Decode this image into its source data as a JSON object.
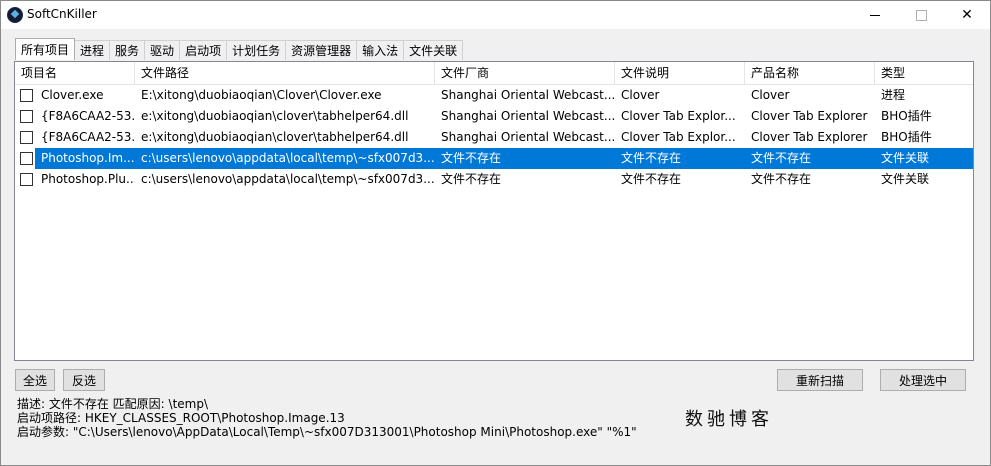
{
  "window": {
    "title": "SoftCnKiller"
  },
  "tabs": [
    "所有项目",
    "进程",
    "服务",
    "驱动",
    "启动项",
    "计划任务",
    "资源管理器",
    "输入法",
    "文件关联"
  ],
  "columns": [
    "项目名",
    "文件路径",
    "文件厂商",
    "文件说明",
    "产品名称",
    "类型"
  ],
  "rows": [
    {
      "name": "Clover.exe",
      "path": "E:\\xitong\\duobiaoqian\\Clover\\Clover.exe",
      "vendor": "Shanghai Oriental Webcast...",
      "desc": "Clover",
      "product": "Clover",
      "type": "进程"
    },
    {
      "name": "{F8A6CAA2-53...",
      "path": "e:\\xitong\\duobiaoqian\\clover\\tabhelper64.dll",
      "vendor": "Shanghai Oriental Webcast...",
      "desc": "Clover Tab Explor...",
      "product": "Clover Tab Explorer",
      "type": "BHO插件"
    },
    {
      "name": "{F8A6CAA2-53...",
      "path": "e:\\xitong\\duobiaoqian\\clover\\tabhelper64.dll",
      "vendor": "Shanghai Oriental Webcast...",
      "desc": "Clover Tab Explor...",
      "product": "Clover Tab Explorer",
      "type": "BHO插件"
    },
    {
      "name": "Photoshop.Im...",
      "path": "c:\\users\\lenovo\\appdata\\local\\temp\\~sfx007d3...",
      "vendor": "文件不存在",
      "desc": "文件不存在",
      "product": "文件不存在",
      "type": "文件关联"
    },
    {
      "name": "Photoshop.Plu...",
      "path": "c:\\users\\lenovo\\appdata\\local\\temp\\~sfx007d3...",
      "vendor": "文件不存在",
      "desc": "文件不存在",
      "product": "文件不存在",
      "type": "文件关联"
    }
  ],
  "buttons": {
    "select_all": "全选",
    "invert": "反选",
    "rescan": "重新扫描",
    "process": "处理选中"
  },
  "details": {
    "description": "描述:  文件不存在   匹配原因: \\temp\\",
    "startup_path": "启动项路径:  HKEY_CLASSES_ROOT\\Photoshop.Image.13",
    "startup_args": "启动参数:  \"C:\\Users\\lenovo\\AppData\\Local\\Temp\\~sfx007D313001\\Photoshop Mini\\Photoshop.exe\" \"%1\""
  },
  "watermark": "数驰博客",
  "colors": {
    "selection": "#0078d7"
  }
}
